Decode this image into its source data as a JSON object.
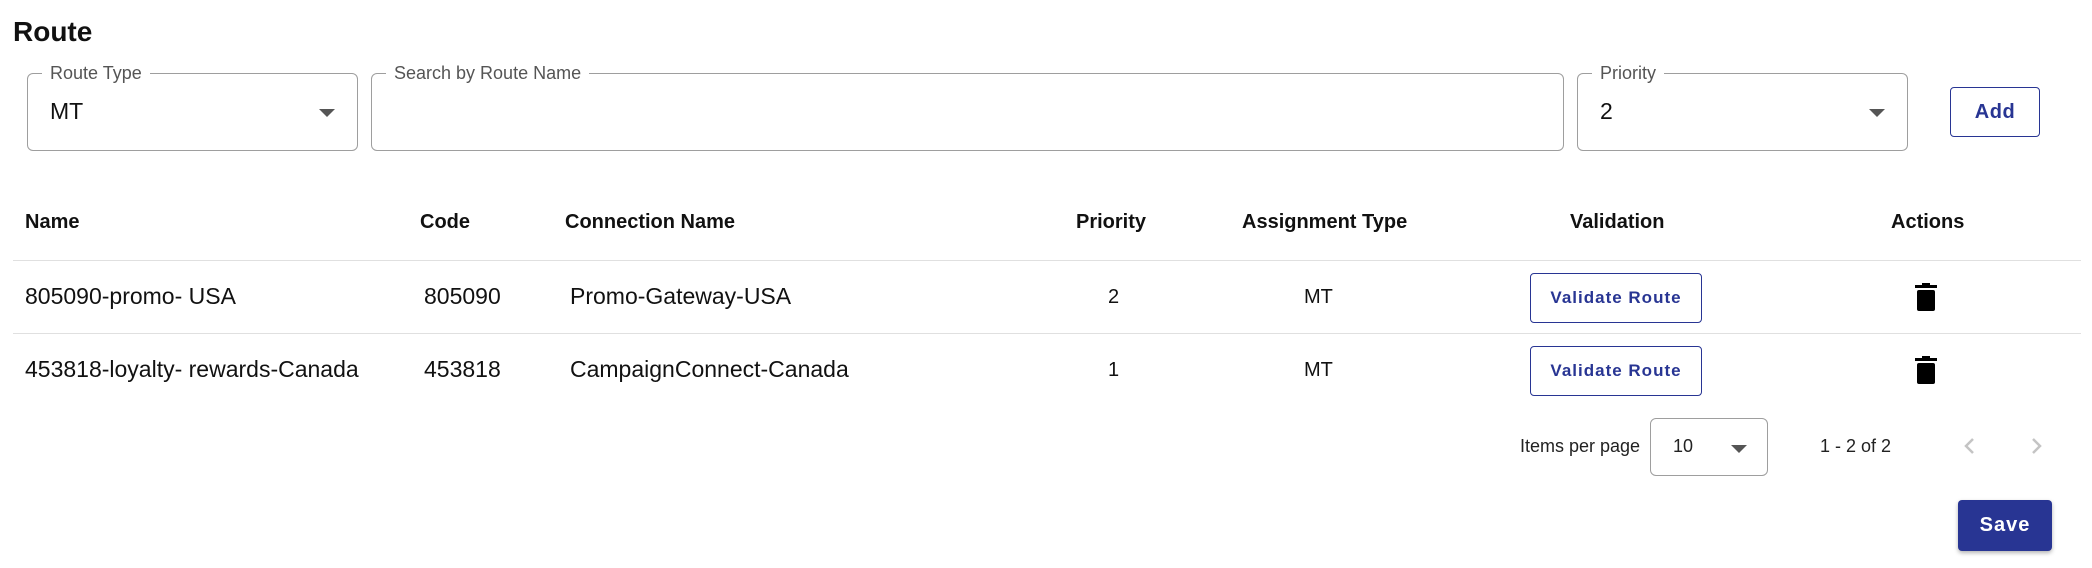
{
  "page": {
    "title": "Route"
  },
  "filters": {
    "route_type": {
      "label": "Route Type",
      "value": "MT"
    },
    "search": {
      "label": "Search by Route Name",
      "value": ""
    },
    "priority": {
      "label": "Priority",
      "value": "2"
    },
    "add_label": "Add"
  },
  "table": {
    "columns": [
      "Name",
      "Code",
      "Connection Name",
      "Priority",
      "Assignment Type",
      "Validation",
      "Actions"
    ],
    "rows": [
      {
        "name": "805090-promo- USA",
        "code": "805090",
        "connection_name": "Promo-Gateway-USA",
        "priority": "2",
        "assignment_type": "MT",
        "validate_label": "Validate Route",
        "action_icon": "trash-icon"
      },
      {
        "name": "453818-loyalty- rewards-Canada",
        "code": "453818",
        "connection_name": "CampaignConnect-Canada",
        "priority": "1",
        "assignment_type": "MT",
        "validate_label": "Validate Route",
        "action_icon": "trash-icon"
      }
    ]
  },
  "pagination": {
    "items_per_page_label": "Items per page",
    "items_per_page_value": "10",
    "range_text": "1 - 2 of 2",
    "prev_icon": "chevron-left-icon",
    "next_icon": "chevron-right-icon"
  },
  "save_label": "Save",
  "colors": {
    "primary": "#283593",
    "border": "#9e9e9e",
    "divider": "#e0e0e0",
    "disabled_icon": "#c4c4c4"
  }
}
